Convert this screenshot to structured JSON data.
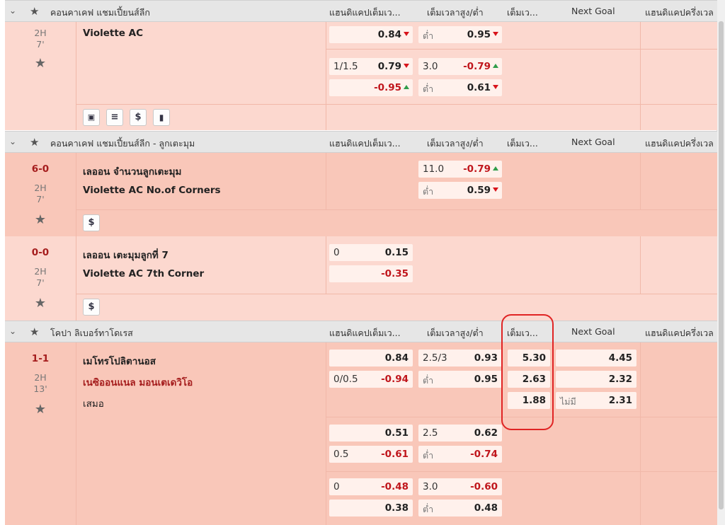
{
  "columns": [
    "แฮนดิแคปเต็มเว...",
    "เต็มเวลาสูง/ต่ำ",
    "เต็มเว...",
    "Next Goal",
    "แฮนดิแคปครึ่งเวล"
  ],
  "leagues": [
    {
      "name": "คอนคาเคฟ แชมเปี้ยนส์ลีก"
    },
    {
      "name": "คอนคาเคฟ แชมเปี้ยนส์ลีก - ลูกเตะมุม"
    },
    {
      "name": "โคปา ลิเบอร์ทาโดเรส"
    }
  ],
  "m1": {
    "period": "2H",
    "minute": "7'",
    "team": "Violette AC",
    "r1": {
      "hv": "0.84",
      "ou_label": "ต่ำ",
      "ouv": "0.95"
    },
    "r2": {
      "hcap": "1/1.5",
      "hv": "0.79",
      "ou": "3.0",
      "ouv": "-0.79"
    },
    "r3": {
      "hv": "-0.95",
      "ou_label": "ต่ำ",
      "ouv": "0.61"
    }
  },
  "m2": {
    "score": "6-0",
    "period": "2H",
    "minute": "7'",
    "team1": "เลออน จำนวนลูกเตะมุม",
    "team2": "Violette AC No.of Corners",
    "ou": "11.0",
    "ouv1": "-0.79",
    "ou_label": "ต่ำ",
    "ouv2": "0.59",
    "dollar": "$"
  },
  "m3": {
    "score": "0-0",
    "period": "2H",
    "minute": "7'",
    "team1": "เลออน เตะมุมลูกที่ 7",
    "team2": "Violette AC 7th Corner",
    "hcap": "0",
    "hv1": "0.15",
    "hv2": "-0.35",
    "dollar": "$"
  },
  "m4": {
    "score": "1-1",
    "period": "2H",
    "minute": "13'",
    "home": "เมโทรโปลิตานอส",
    "away": "เนซิออนแนล มอนเตเดวิโอ",
    "draw": "เสมอ",
    "r1": {
      "hv": "0.84",
      "ou": "2.5/3",
      "ouv": "0.93",
      "x12": "5.30",
      "ng": "4.45"
    },
    "r2": {
      "hcap": "0/0.5",
      "hv": "-0.94",
      "ou_label": "ต่ำ",
      "ouv": "0.95",
      "x12": "2.63",
      "ng": "2.32"
    },
    "r3": {
      "x12": "1.88",
      "ng_label": "ไม่มี",
      "ng": "2.31"
    },
    "r4": {
      "hv": "0.51",
      "ou": "2.5",
      "ouv": "0.62"
    },
    "r5": {
      "hcap": "0.5",
      "hv": "-0.61",
      "ou_label": "ต่ำ",
      "ouv": "-0.74"
    },
    "r6": {
      "hcap": "0",
      "hv": "-0.48",
      "ou": "3.0",
      "ouv": "-0.60"
    },
    "r7": {
      "hv": "0.38",
      "ou_label": "ต่ำ",
      "ouv": "0.48"
    }
  },
  "icons": {
    "dollar": "$"
  }
}
